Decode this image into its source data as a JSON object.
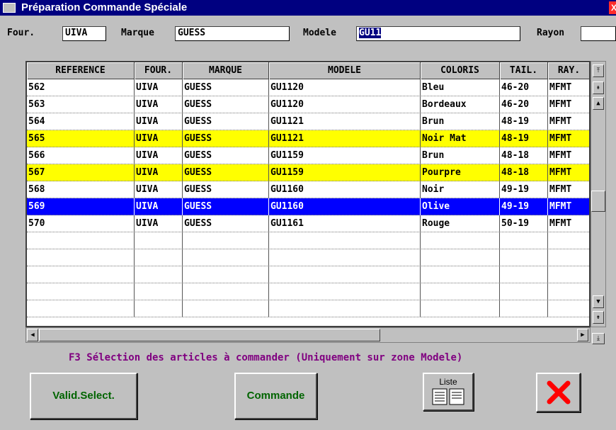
{
  "window": {
    "title": "Préparation Commande Spéciale",
    "close_glyph": "X"
  },
  "filters": {
    "four_label": "Four.",
    "four_value": "UIVA",
    "marque_label": "Marque",
    "marque_value": "GUESS",
    "modele_label": "Modele",
    "modele_value": "GU11",
    "rayon_label": "Rayon",
    "rayon_value": ""
  },
  "table": {
    "headers": [
      "REFERENCE",
      "FOUR.",
      "MARQUE",
      "MODELE",
      "COLORIS",
      "TAIL.",
      "RAY."
    ],
    "rows": [
      {
        "ref": "562",
        "four": "UIVA",
        "marque": "GUESS",
        "modele": "GU1120",
        "coloris": "Bleu",
        "tail": "46-20",
        "ray": "MFMT",
        "style": "white"
      },
      {
        "ref": "563",
        "four": "UIVA",
        "marque": "GUESS",
        "modele": "GU1120",
        "coloris": "Bordeaux",
        "tail": "46-20",
        "ray": "MFMT",
        "style": "white"
      },
      {
        "ref": "564",
        "four": "UIVA",
        "marque": "GUESS",
        "modele": "GU1121",
        "coloris": "Brun",
        "tail": "48-19",
        "ray": "MFMT",
        "style": "white"
      },
      {
        "ref": "565",
        "four": "UIVA",
        "marque": "GUESS",
        "modele": "GU1121",
        "coloris": "Noir Mat",
        "tail": "48-19",
        "ray": "MFMT",
        "style": "yellow"
      },
      {
        "ref": "566",
        "four": "UIVA",
        "marque": "GUESS",
        "modele": "GU1159",
        "coloris": "Brun",
        "tail": "48-18",
        "ray": "MFMT",
        "style": "white"
      },
      {
        "ref": "567",
        "four": "UIVA",
        "marque": "GUESS",
        "modele": "GU1159",
        "coloris": "Pourpre",
        "tail": "48-18",
        "ray": "MFMT",
        "style": "yellow"
      },
      {
        "ref": "568",
        "four": "UIVA",
        "marque": "GUESS",
        "modele": "GU1160",
        "coloris": "Noir",
        "tail": "49-19",
        "ray": "MFMT",
        "style": "white"
      },
      {
        "ref": "569",
        "four": "UIVA",
        "marque": "GUESS",
        "modele": "GU1160",
        "coloris": "Olive",
        "tail": "49-19",
        "ray": "MFMT",
        "style": "blue"
      },
      {
        "ref": "570",
        "four": "UIVA",
        "marque": "GUESS",
        "modele": "GU1161",
        "coloris": "Rouge",
        "tail": "50-19",
        "ray": "MFMT",
        "style": "white"
      }
    ],
    "empty_rows": 5
  },
  "hint": "F3 Sélection des articles à commander (Uniquement sur zone Modele)",
  "buttons": {
    "valid_label": "Valid.Select.",
    "commande_label": "Commande",
    "liste_label": "Liste"
  },
  "colors": {
    "title_bar": "#000080",
    "highlight_yellow": "#ffff00",
    "selected_blue": "#0000ff",
    "hint_text": "#800080",
    "button_text": "#006400",
    "close_x": "#ff0000"
  },
  "icons": {
    "liste": "list-icon",
    "close": "red-x-icon",
    "scroll_top": "scroll-top-icon",
    "scroll_up": "arrow-up-icon",
    "scroll_down": "arrow-down-icon",
    "scroll_bottom": "scroll-bottom-icon"
  }
}
